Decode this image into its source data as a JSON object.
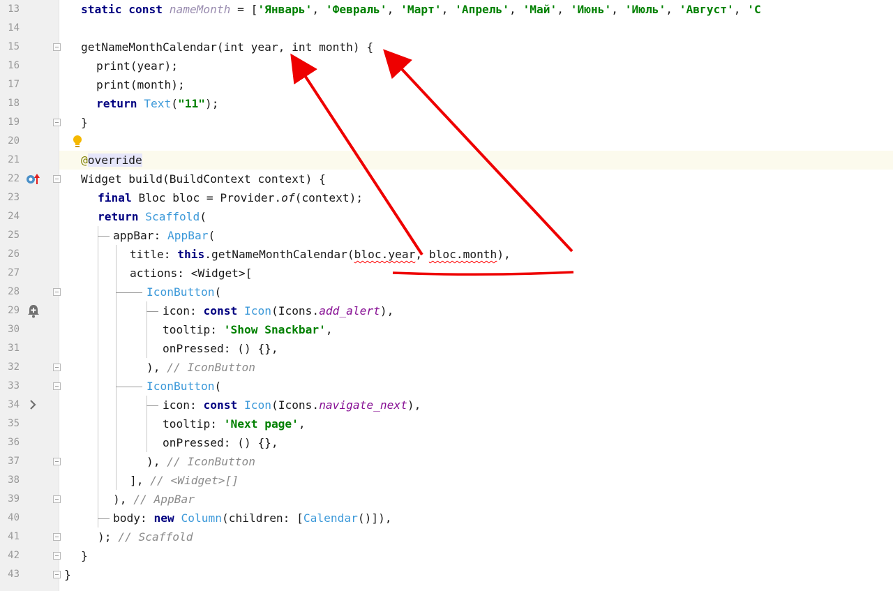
{
  "gutter": {
    "line_numbers": [
      "13",
      "14",
      "15",
      "16",
      "17",
      "18",
      "19",
      "20",
      "21",
      "22",
      "23",
      "24",
      "25",
      "26",
      "27",
      "28",
      "29",
      "30",
      "31",
      "32",
      "33",
      "34",
      "35",
      "36",
      "37",
      "38",
      "39",
      "40",
      "41",
      "42",
      "43"
    ]
  },
  "icons": {
    "bulb": "lightbulb-icon",
    "override": "override-marker-icon",
    "bell": "add-alert-icon",
    "chevron": "chevron-right-icon"
  },
  "colors": {
    "keyword": "#000080",
    "string": "#008000",
    "type": "#3c99d9",
    "comment": "#8c8c8c",
    "annotation_arrow": "#ee0000"
  },
  "code": {
    "l13": {
      "kw1": "static const",
      "name": "nameMonth",
      "eq": " = [",
      "s1": "'Январь'",
      "s2": "'Февраль'",
      "s3": "'Март'",
      "s4": "'Апрель'",
      "s5": "'Май'",
      "s6": "'Июнь'",
      "s7": "'Июль'",
      "s8": "'Август'",
      "s9": "'С",
      "sep": ", "
    },
    "l15": "getNameMonthCalendar(int year, int month) {",
    "l16": "print(year);",
    "l17": "print(month);",
    "l18": {
      "kw": "return",
      "ty": "Text",
      "open": "(",
      "str": "\"11\"",
      "close": ");"
    },
    "l19": "}",
    "l21": {
      "at": "@",
      "name": "override"
    },
    "l22": "Widget build(BuildContext context) {",
    "l23": {
      "kw": "final",
      "a": " Bloc bloc = Provider.",
      "of": "of",
      "b": "(context);"
    },
    "l24": {
      "kw": "return",
      "ty": "Scaffold",
      "open": "("
    },
    "l25": {
      "a": "appBar: ",
      "ty": "AppBar",
      "open": "("
    },
    "l26": {
      "a": "title: ",
      "kw": "this",
      "b": ".getNameMonthCalendar(",
      "arg1": "bloc.year",
      "comma": ", ",
      "arg2": "bloc.month",
      "c": "),"
    },
    "l27": "actions: <Widget>[",
    "l28": {
      "ty": "IconButton",
      "open": "("
    },
    "l29": {
      "a": "icon: ",
      "kw": "const",
      "ty": "Icon",
      "b": "(Icons.",
      "m": "add_alert",
      "c": "),"
    },
    "l30": {
      "a": "tooltip: ",
      "str": "'Show Snackbar'",
      "c": ","
    },
    "l31": "onPressed: () {},",
    "l32": {
      "a": "), ",
      "cm": "// IconButton"
    },
    "l33": {
      "ty": "IconButton",
      "open": "("
    },
    "l34": {
      "a": "icon: ",
      "kw": "const",
      "ty": "Icon",
      "b": "(Icons.",
      "m": "navigate_next",
      "c": "),"
    },
    "l35": {
      "a": "tooltip: ",
      "str": "'Next page'",
      "c": ","
    },
    "l36": "onPressed: () {},",
    "l37": {
      "a": "), ",
      "cm": "// IconButton"
    },
    "l38": {
      "a": "], ",
      "cm": "// <Widget>[]"
    },
    "l39": {
      "a": "), ",
      "cm": "// AppBar"
    },
    "l40": {
      "a": "body: ",
      "kw": "new",
      "ty1": "Column",
      "b": "(children: [",
      "ty2": "Calendar",
      "c": "()]),"
    },
    "l41": {
      "a": "); ",
      "cm": "// Scaffold"
    },
    "l42": "}",
    "l43": "}"
  }
}
